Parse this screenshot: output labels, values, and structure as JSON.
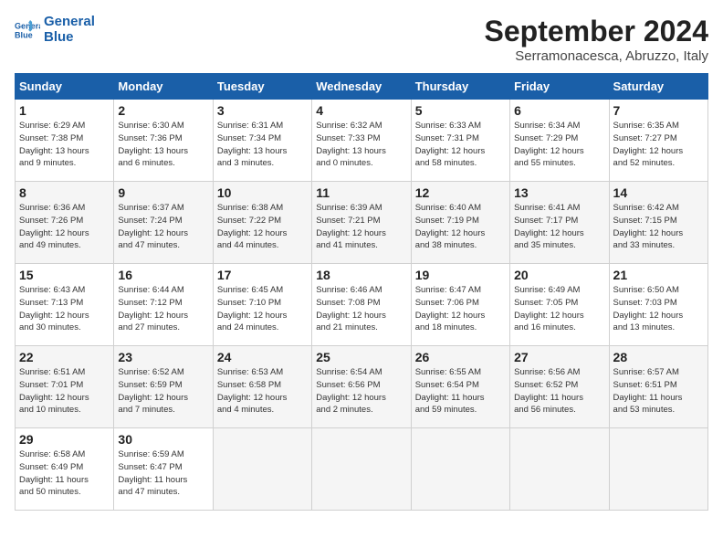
{
  "header": {
    "logo_line1": "General",
    "logo_line2": "Blue",
    "month": "September 2024",
    "location": "Serramonacesca, Abruzzo, Italy"
  },
  "days_of_week": [
    "Sunday",
    "Monday",
    "Tuesday",
    "Wednesday",
    "Thursday",
    "Friday",
    "Saturday"
  ],
  "weeks": [
    [
      {
        "day": "1",
        "info": "Sunrise: 6:29 AM\nSunset: 7:38 PM\nDaylight: 13 hours\nand 9 minutes."
      },
      {
        "day": "2",
        "info": "Sunrise: 6:30 AM\nSunset: 7:36 PM\nDaylight: 13 hours\nand 6 minutes."
      },
      {
        "day": "3",
        "info": "Sunrise: 6:31 AM\nSunset: 7:34 PM\nDaylight: 13 hours\nand 3 minutes."
      },
      {
        "day": "4",
        "info": "Sunrise: 6:32 AM\nSunset: 7:33 PM\nDaylight: 13 hours\nand 0 minutes."
      },
      {
        "day": "5",
        "info": "Sunrise: 6:33 AM\nSunset: 7:31 PM\nDaylight: 12 hours\nand 58 minutes."
      },
      {
        "day": "6",
        "info": "Sunrise: 6:34 AM\nSunset: 7:29 PM\nDaylight: 12 hours\nand 55 minutes."
      },
      {
        "day": "7",
        "info": "Sunrise: 6:35 AM\nSunset: 7:27 PM\nDaylight: 12 hours\nand 52 minutes."
      }
    ],
    [
      {
        "day": "8",
        "info": "Sunrise: 6:36 AM\nSunset: 7:26 PM\nDaylight: 12 hours\nand 49 minutes."
      },
      {
        "day": "9",
        "info": "Sunrise: 6:37 AM\nSunset: 7:24 PM\nDaylight: 12 hours\nand 47 minutes."
      },
      {
        "day": "10",
        "info": "Sunrise: 6:38 AM\nSunset: 7:22 PM\nDaylight: 12 hours\nand 44 minutes."
      },
      {
        "day": "11",
        "info": "Sunrise: 6:39 AM\nSunset: 7:21 PM\nDaylight: 12 hours\nand 41 minutes."
      },
      {
        "day": "12",
        "info": "Sunrise: 6:40 AM\nSunset: 7:19 PM\nDaylight: 12 hours\nand 38 minutes."
      },
      {
        "day": "13",
        "info": "Sunrise: 6:41 AM\nSunset: 7:17 PM\nDaylight: 12 hours\nand 35 minutes."
      },
      {
        "day": "14",
        "info": "Sunrise: 6:42 AM\nSunset: 7:15 PM\nDaylight: 12 hours\nand 33 minutes."
      }
    ],
    [
      {
        "day": "15",
        "info": "Sunrise: 6:43 AM\nSunset: 7:13 PM\nDaylight: 12 hours\nand 30 minutes."
      },
      {
        "day": "16",
        "info": "Sunrise: 6:44 AM\nSunset: 7:12 PM\nDaylight: 12 hours\nand 27 minutes."
      },
      {
        "day": "17",
        "info": "Sunrise: 6:45 AM\nSunset: 7:10 PM\nDaylight: 12 hours\nand 24 minutes."
      },
      {
        "day": "18",
        "info": "Sunrise: 6:46 AM\nSunset: 7:08 PM\nDaylight: 12 hours\nand 21 minutes."
      },
      {
        "day": "19",
        "info": "Sunrise: 6:47 AM\nSunset: 7:06 PM\nDaylight: 12 hours\nand 18 minutes."
      },
      {
        "day": "20",
        "info": "Sunrise: 6:49 AM\nSunset: 7:05 PM\nDaylight: 12 hours\nand 16 minutes."
      },
      {
        "day": "21",
        "info": "Sunrise: 6:50 AM\nSunset: 7:03 PM\nDaylight: 12 hours\nand 13 minutes."
      }
    ],
    [
      {
        "day": "22",
        "info": "Sunrise: 6:51 AM\nSunset: 7:01 PM\nDaylight: 12 hours\nand 10 minutes."
      },
      {
        "day": "23",
        "info": "Sunrise: 6:52 AM\nSunset: 6:59 PM\nDaylight: 12 hours\nand 7 minutes."
      },
      {
        "day": "24",
        "info": "Sunrise: 6:53 AM\nSunset: 6:58 PM\nDaylight: 12 hours\nand 4 minutes."
      },
      {
        "day": "25",
        "info": "Sunrise: 6:54 AM\nSunset: 6:56 PM\nDaylight: 12 hours\nand 2 minutes."
      },
      {
        "day": "26",
        "info": "Sunrise: 6:55 AM\nSunset: 6:54 PM\nDaylight: 11 hours\nand 59 minutes."
      },
      {
        "day": "27",
        "info": "Sunrise: 6:56 AM\nSunset: 6:52 PM\nDaylight: 11 hours\nand 56 minutes."
      },
      {
        "day": "28",
        "info": "Sunrise: 6:57 AM\nSunset: 6:51 PM\nDaylight: 11 hours\nand 53 minutes."
      }
    ],
    [
      {
        "day": "29",
        "info": "Sunrise: 6:58 AM\nSunset: 6:49 PM\nDaylight: 11 hours\nand 50 minutes."
      },
      {
        "day": "30",
        "info": "Sunrise: 6:59 AM\nSunset: 6:47 PM\nDaylight: 11 hours\nand 47 minutes."
      },
      {
        "day": "",
        "info": ""
      },
      {
        "day": "",
        "info": ""
      },
      {
        "day": "",
        "info": ""
      },
      {
        "day": "",
        "info": ""
      },
      {
        "day": "",
        "info": ""
      }
    ]
  ]
}
